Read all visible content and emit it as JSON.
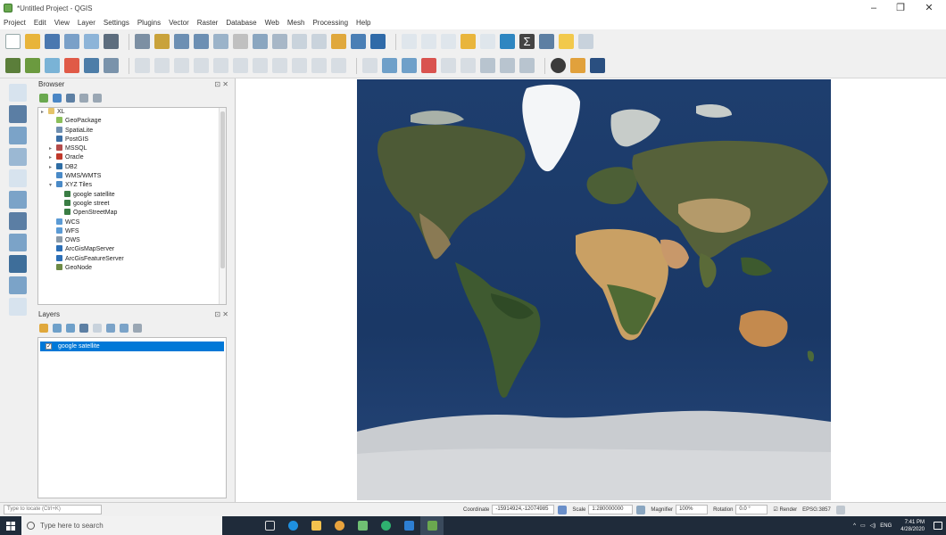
{
  "window": {
    "title": "*Untitled Project - QGIS",
    "controls": [
      "–",
      "❐",
      "✕"
    ]
  },
  "menubar": [
    "Project",
    "Edit",
    "View",
    "Layer",
    "Settings",
    "Plugins",
    "Vector",
    "Raster",
    "Database",
    "Web",
    "Mesh",
    "Processing",
    "Help"
  ],
  "browser": {
    "title": "Browser",
    "close": "⊡ ✕",
    "items": [
      {
        "label": "XL",
        "icon": "folder-icon",
        "indent": 0,
        "expander": "▸"
      },
      {
        "label": "GeoPackage",
        "icon": "geopackage-icon",
        "indent": 1,
        "expander": ""
      },
      {
        "label": "SpatiaLite",
        "icon": "spatialite-icon",
        "indent": 1,
        "expander": ""
      },
      {
        "label": "PostGIS",
        "icon": "postgis-icon",
        "indent": 1,
        "expander": ""
      },
      {
        "label": "MSSQL",
        "icon": "mssql-icon",
        "indent": 1,
        "expander": "▸"
      },
      {
        "label": "Oracle",
        "icon": "oracle-icon",
        "indent": 1,
        "expander": "▸"
      },
      {
        "label": "DB2",
        "icon": "db2-icon",
        "indent": 1,
        "expander": "▸"
      },
      {
        "label": "WMS/WMTS",
        "icon": "wms-icon",
        "indent": 1,
        "expander": ""
      },
      {
        "label": "XYZ Tiles",
        "icon": "xyz-icon",
        "indent": 1,
        "expander": "▾"
      },
      {
        "label": "google satellite",
        "icon": "xyz-layer-icon",
        "indent": 2,
        "expander": ""
      },
      {
        "label": "google street",
        "icon": "xyz-layer-icon",
        "indent": 2,
        "expander": ""
      },
      {
        "label": "OpenStreetMap",
        "icon": "xyz-layer-icon",
        "indent": 2,
        "expander": ""
      },
      {
        "label": "WCS",
        "icon": "wcs-icon",
        "indent": 1,
        "expander": ""
      },
      {
        "label": "WFS",
        "icon": "wfs-icon",
        "indent": 1,
        "expander": ""
      },
      {
        "label": "OWS",
        "icon": "ows-icon",
        "indent": 1,
        "expander": ""
      },
      {
        "label": "ArcGisMapServer",
        "icon": "arcgis-icon",
        "indent": 1,
        "expander": ""
      },
      {
        "label": "ArcGisFeatureServer",
        "icon": "arcgis-icon",
        "indent": 1,
        "expander": ""
      },
      {
        "label": "GeoNode",
        "icon": "geonode-icon",
        "indent": 1,
        "expander": ""
      }
    ]
  },
  "layers": {
    "title": "Layers",
    "close": "⊡ ✕",
    "items": [
      {
        "label": "google satellite",
        "checked": true
      }
    ]
  },
  "statusbar": {
    "locator_placeholder": "Type to locate (Ctrl+K)",
    "coordinate_label": "Coordinate",
    "coordinate_value": "-15914924,-12074985",
    "scale_label": "Scale",
    "scale_value": "1:280000000",
    "magnifier_label": "Magnifier",
    "magnifier_value": "100%",
    "rotation_label": "Rotation",
    "rotation_value": "0.0 °",
    "render_label": "Render",
    "crs_label": "EPSG:3857"
  },
  "taskbar": {
    "search_placeholder": "Type here to search",
    "time": "7:41 PM",
    "date": "4/28/2020",
    "language": "ENG"
  },
  "colors": {
    "selection": "#0078d7",
    "ocean": "#1c3b6b",
    "taskbar": "#1f2b3a"
  }
}
